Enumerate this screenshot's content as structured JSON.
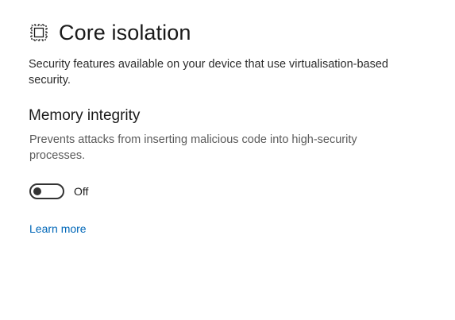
{
  "header": {
    "icon": "core-isolation-chip-icon",
    "title": "Core isolation"
  },
  "page": {
    "description": "Security features available on your device that use virtualisation-based security."
  },
  "memory_integrity": {
    "title": "Memory integrity",
    "description": "Prevents attacks from inserting malicious code into high-security processes.",
    "toggle": {
      "state": "off",
      "label": "Off"
    }
  },
  "links": {
    "learn_more": "Learn more"
  },
  "colors": {
    "link": "#0067b8",
    "toggle_off": "#333333",
    "secondary_text": "#5a5a5a"
  }
}
